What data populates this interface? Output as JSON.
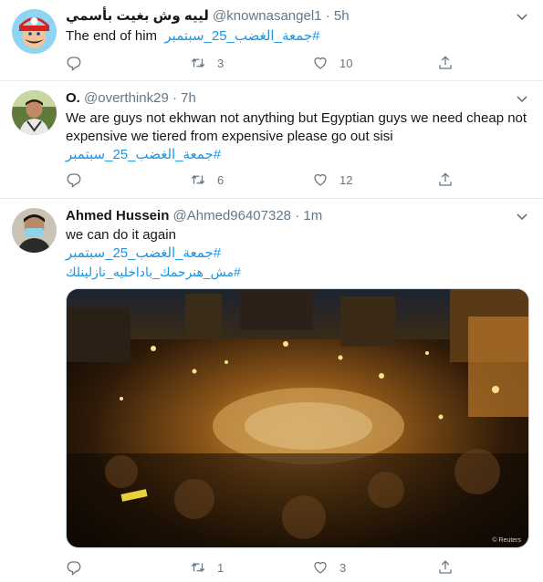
{
  "tweets": [
    {
      "name": "لييه وش بغيت بأسمي",
      "handle": "@knownasangel1",
      "time": "5h",
      "text": "The end of him",
      "hashtags": [
        "#جمعة_الغضب_25_سبتمبر"
      ],
      "replies": "",
      "retweets": "3",
      "likes": "10"
    },
    {
      "name": "O.",
      "handle": "@overthink29",
      "time": "7h",
      "text": "We are guys not ekhwan not anything but Egyptian guys we need cheap not expensive we tiered from expensive please go out sisi",
      "hashtags": [
        "#جمعة_الغضب_25_سبتمبر"
      ],
      "replies": "",
      "retweets": "6",
      "likes": "12"
    },
    {
      "name": "Ahmed Hussein",
      "handle": "@Ahmed96407328",
      "time": "1m",
      "text": "we can do it again",
      "hashtags": [
        "#جمعة_الغضب_25_سبتمبر",
        "#مش_هنرحمك_باداخليه_نازلينلك"
      ],
      "replies": "",
      "retweets": "1",
      "likes": "3",
      "media_credit": "© Reuters"
    }
  ],
  "icons": {
    "reply": "reply-icon",
    "retweet": "retweet-icon",
    "like": "heart-icon",
    "share": "share-icon",
    "caret": "chevron-down-icon"
  },
  "colors": {
    "link": "#1b95e0",
    "secondary": "#657786",
    "divider": "#e6ecf0"
  }
}
